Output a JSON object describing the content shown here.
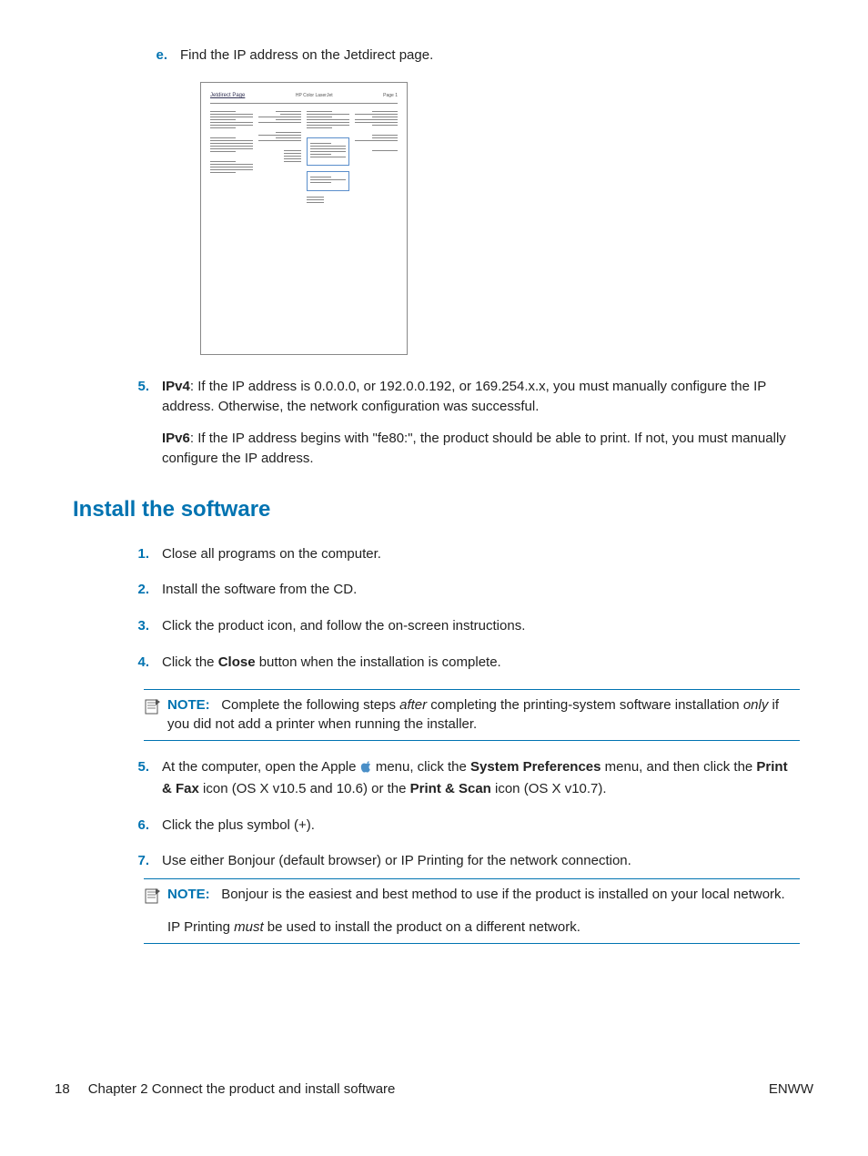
{
  "step_e": {
    "marker": "e.",
    "text": "Find the IP address on the Jetdirect page."
  },
  "jetdirect_fig": {
    "title": "Jetdirect Page",
    "model": "HP Color LaserJet",
    "page": "Page 1"
  },
  "step5": {
    "marker": "5.",
    "ipv4_label": "IPv4",
    "ipv4_text": ": If the IP address is 0.0.0.0, or 192.0.0.192, or 169.254.x.x, you must manually configure the IP address. Otherwise, the network configuration was successful.",
    "ipv6_label": "IPv6",
    "ipv6_text": ": If the IP address begins with \"fe80:\", the product should be able to print. If not, you must manually configure the IP address."
  },
  "section_heading": "Install the software",
  "install": {
    "s1": {
      "m": "1.",
      "t": "Close all programs on the computer."
    },
    "s2": {
      "m": "2.",
      "t": "Install the software from the CD."
    },
    "s3": {
      "m": "3.",
      "t": "Click the product icon, and follow the on-screen instructions."
    },
    "s4": {
      "m": "4.",
      "t1": "Click the ",
      "close": "Close",
      "t2": " button when the installation is complete."
    },
    "note1": {
      "label": "NOTE:",
      "t1": "Complete the following steps ",
      "after": "after",
      "t2": " completing the printing-system software installation ",
      "only": "only",
      "t3": " if you did not add a printer when running the installer."
    },
    "s5": {
      "m": "5.",
      "t1": "At the computer, open the Apple ",
      "t2": " menu, click the ",
      "sysprefs": "System Preferences",
      "t3": " menu, and then click the ",
      "pfax": "Print & Fax",
      "t4": " icon (OS X v10.5 and 10.6) or the ",
      "pscan": "Print & Scan",
      "t5": " icon (OS X v10.7)."
    },
    "s6": {
      "m": "6.",
      "t": "Click the plus symbol (+)."
    },
    "s7": {
      "m": "7.",
      "t": "Use either Bonjour (default browser) or IP Printing for the network connection."
    },
    "note2": {
      "label": "NOTE:",
      "t1": "Bonjour is the easiest and best method to use if the product is installed on your local network.",
      "t2a": "IP Printing ",
      "must": "must",
      "t2b": " be used to install the product on a different network."
    }
  },
  "footer": {
    "page_num": "18",
    "chapter": "Chapter 2   Connect the product and install software",
    "lang": "ENWW"
  }
}
